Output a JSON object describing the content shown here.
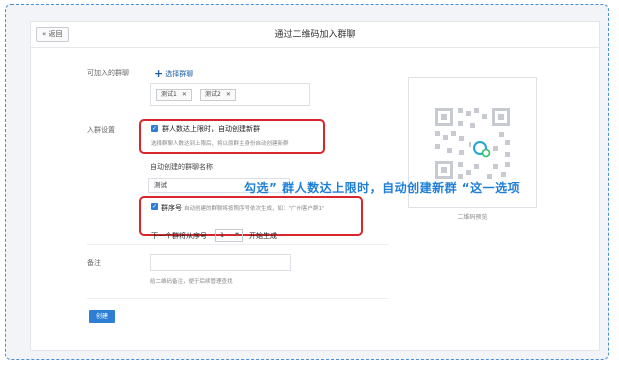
{
  "header": {
    "back_label": "« 返回",
    "title": "通过二维码加入群聊"
  },
  "groups": {
    "label": "可加入的群聊",
    "add_label": "选择群聊",
    "tags": [
      "测试1",
      "测试2"
    ]
  },
  "settings": {
    "label": "入群设置",
    "auto_create": {
      "checked": true,
      "title": "群人数达上限时，自动创建新群",
      "desc": "选择群聊人数达到上限后，将以原群主身份自动创建新群"
    },
    "name_label": "自动创建的群聊名称",
    "name_value": "测试",
    "serial": {
      "checked": true,
      "title": "群序号",
      "desc": "自动创建的群聊将按照序号依次生成，如：\"广州客户群1\"",
      "start_label": "下一个群将从序号",
      "start_value": "1",
      "start_suffix": "开始生成"
    }
  },
  "remark": {
    "label": "备注",
    "value": "",
    "hint": "给二维码备注，便于后续管理查找"
  },
  "create_label": "创建",
  "qr": {
    "caption": "二维码预览"
  },
  "annotation": "勾选” 群人数达上限时，自动创建新群 “这一选项",
  "colors": {
    "accent": "#2e7fd4",
    "highlight": "#d9262c",
    "annotation": "#1f7fd6"
  }
}
